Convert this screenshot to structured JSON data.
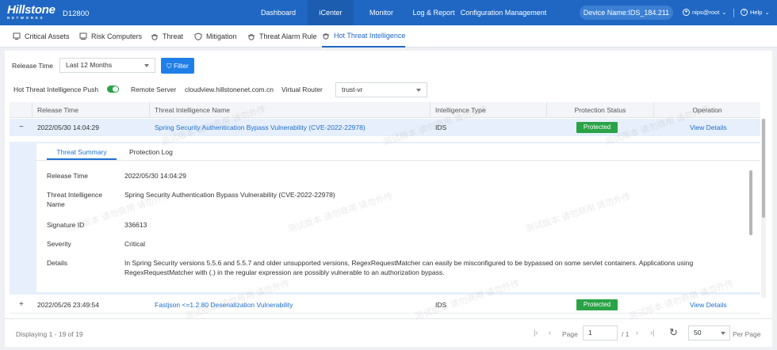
{
  "brand": {
    "logo_main": "Hillstone",
    "logo_sub": "NETWORKS",
    "model": "D12800"
  },
  "topnav": [
    {
      "label": "Dashboard"
    },
    {
      "label": "iCenter"
    },
    {
      "label": "Monitor"
    },
    {
      "label": "Log & Report"
    },
    {
      "label": "Configuration Management"
    }
  ],
  "device_name": "Device Name:IDS_184.211",
  "user": "nips@root",
  "help": "Help",
  "subtabs": [
    {
      "label": "Critical Assets"
    },
    {
      "label": "Risk Computers"
    },
    {
      "label": "Threat"
    },
    {
      "label": "Mitigation"
    },
    {
      "label": "Threat Alarm Rule"
    },
    {
      "label": "Hot Threat Intelligence"
    }
  ],
  "filter": {
    "release_time_label": "Release Time",
    "release_time_value": "Last 12 Months",
    "filter_button": "Filter",
    "push_label": "Hot Threat Intelligence Push",
    "push_enabled": true,
    "remote_server_label": "Remote Server",
    "remote_server_value": "cloudview.hillstonenet.com.cn",
    "virtual_router_label": "Virtual Router",
    "virtual_router_value": "trust-vr"
  },
  "table": {
    "columns": [
      "Release Time",
      "Threat Intelligence Name",
      "Intelligence Type",
      "Protection Status",
      "Operation"
    ],
    "rows": [
      {
        "expand": "−",
        "time": "2022/05/30 14:04:29",
        "name": "Spring Security Authentication Bypass Vulnerability (CVE-2022-22978)",
        "type": "IDS",
        "status": "Protected",
        "op": "View Details"
      },
      {
        "expand": "+",
        "time": "2022/05/26 23:49:54",
        "name": "Fastjson <=1.2.80 Deserialization Vulnerability",
        "type": "IDS",
        "status": "Protected",
        "op": "View Details"
      }
    ]
  },
  "detail": {
    "tabs": [
      "Threat Summary",
      "Protection Log"
    ],
    "fields": [
      {
        "label": "Release Time",
        "value": "2022/05/30 14:04:29"
      },
      {
        "label": "Threat Intelligence Name",
        "value": "Spring Security Authentication Bypass Vulnerability (CVE-2022-22978)"
      },
      {
        "label": "Signature ID",
        "value": "336613"
      },
      {
        "label": "Severity",
        "value": "Critical"
      },
      {
        "label": "Details",
        "value": "In Spring Security versions 5.5.6 and 5.5.7 and older unsupported versions, RegexRequestMatcher can easily be misconfigured to be bypassed on some servlet containers. Applications using RegexRequestMatcher with (.) in the regular expression are possibly vulnerable to an authorization bypass."
      }
    ]
  },
  "footer": {
    "displaying": "Displaying 1 - 19 of 19",
    "page_label": "Page",
    "page_value": "1",
    "total_pages": "/ 1",
    "per_page_value": "50",
    "per_page_label": "Per Page"
  },
  "watermark": "测试版本 请勿商用 请勿外传",
  "colors": {
    "brand_blue": "#1f67c3",
    "link": "#1f6fd1",
    "protected_green": "#2aa346"
  }
}
